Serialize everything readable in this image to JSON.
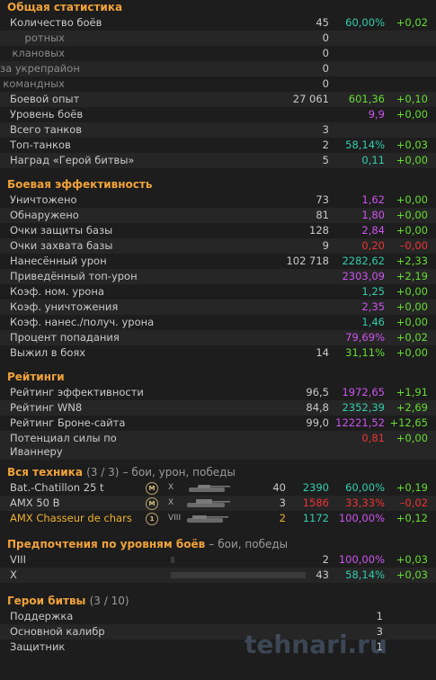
{
  "general": {
    "title": "Общая статистика",
    "battles": {
      "label": "Количество боёв",
      "count": "45",
      "avg": "60,00%",
      "delta": "+0,02"
    },
    "company": {
      "label": "ротных",
      "count": "0"
    },
    "clan": {
      "label": "клановых",
      "count": "0"
    },
    "fort": {
      "label": "за укрепрайон",
      "count": "0"
    },
    "team": {
      "label": "командных",
      "count": "0"
    },
    "xp": {
      "label": "Боевой опыт",
      "count": "27 061",
      "avg": "601,36",
      "delta": "+0,10"
    },
    "level": {
      "label": "Уровень боёв",
      "avg": "9,9",
      "delta": "+0,00"
    },
    "tanks": {
      "label": "Всего танков",
      "count": "3"
    },
    "top": {
      "label": "Топ-танков",
      "count": "2",
      "avg": "58,14%",
      "delta": "+0,03"
    },
    "hero": {
      "label": "Наград «Герой битвы»",
      "count": "5",
      "avg": "0,11",
      "delta": "+0,00"
    }
  },
  "efficiency": {
    "title": "Боевая эффективность",
    "destroyed": {
      "label": "Уничтожено",
      "count": "73",
      "avg": "1,62",
      "delta": "+0,00"
    },
    "spotted": {
      "label": "Обнаружено",
      "count": "81",
      "avg": "1,80",
      "delta": "+0,00"
    },
    "defense": {
      "label": "Очки защиты базы",
      "count": "128",
      "avg": "2,84",
      "delta": "+0,00"
    },
    "capture": {
      "label": "Очки захвата базы",
      "count": "9",
      "avg": "0,20",
      "delta": "–0,00"
    },
    "damage": {
      "label": "Нанесённый урон",
      "count": "102 718",
      "avg": "2282,62",
      "delta": "+2,33"
    },
    "damage_top": {
      "label": "Приведённый топ-урон",
      "avg": "2303,09",
      "delta": "+2,19"
    },
    "dmg_coef": {
      "label": "Коэф. ном. урона",
      "avg": "1,25",
      "delta": "+0,00"
    },
    "kill_coef": {
      "label": "Коэф. уничтожения",
      "avg": "2,35",
      "delta": "+0,00"
    },
    "dmg_ratio": {
      "label": "Коэф. нанес./получ. урона",
      "avg": "1,46",
      "delta": "+0,00"
    },
    "hit": {
      "label": "Процент попадания",
      "avg": "79,69%",
      "delta": "+0,02"
    },
    "survived": {
      "label": "Выжил в боях",
      "count": "14",
      "avg": "31,11%",
      "delta": "+0,00"
    }
  },
  "ratings": {
    "title": "Рейтинги",
    "eff": {
      "label": "Рейтинг эффективности",
      "count": "96,5",
      "avg": "1972,65",
      "delta": "+1,91"
    },
    "wn8": {
      "label": "Рейтинг WN8",
      "count": "84,8",
      "avg": "2352,39",
      "delta": "+2,69"
    },
    "armor": {
      "label": "Рейтинг Броне-сайта",
      "count": "99,0",
      "avg": "12221,52",
      "delta": "+12,65"
    },
    "ivanner": {
      "label": "Потенциал силы по Иваннеру",
      "avg": "0,81",
      "delta": "+0,00"
    }
  },
  "vehicles": {
    "title": "Вся техника",
    "count_text": "(3 / 3)",
    "subtitle": "– бои, урон, победы",
    "rows": [
      {
        "name": "Bat.-Chatillon 25 t",
        "badge": "M",
        "tier": "X",
        "count": "40",
        "dmg": "2390",
        "win": "60,00%",
        "delta": "+0,19"
      },
      {
        "name": "AMX 50 B",
        "badge": "M",
        "tier": "X",
        "count": "3",
        "dmg": "1586",
        "win": "33,33%",
        "delta": "–0,02"
      },
      {
        "name": "AMX Chasseur de chars",
        "badge": "1",
        "tier": "VIII",
        "count": "2",
        "dmg": "1172",
        "win": "100,00%",
        "delta": "+0,12"
      }
    ]
  },
  "tiers": {
    "title": "Предпочтения по уровням боёв",
    "subtitle": "– бои, победы",
    "rows": [
      {
        "label": "VIII",
        "count": "2",
        "avg": "100,00%",
        "delta": "+0,03"
      },
      {
        "label": "X",
        "count": "43",
        "avg": "58,14%",
        "delta": "+0,03"
      }
    ]
  },
  "heroes": {
    "title": "Герои битвы",
    "count_text": "(3 / 10)",
    "rows": [
      {
        "label": "Поддержка",
        "count": "1"
      },
      {
        "label": "Основной калибр",
        "count": "3"
      },
      {
        "label": "Защитник",
        "count": "1"
      }
    ]
  },
  "watermark": "tehnari.ru"
}
